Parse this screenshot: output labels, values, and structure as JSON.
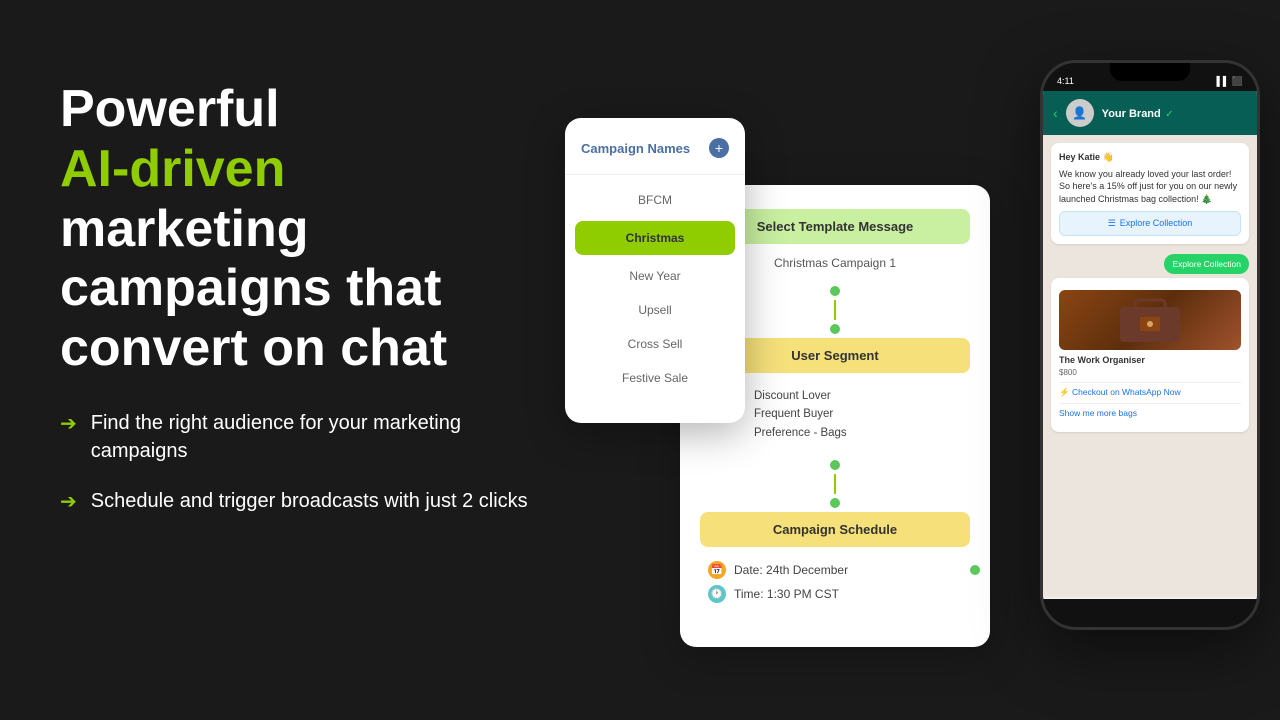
{
  "headline": {
    "line1": "Powerful",
    "line2": "AI-driven",
    "line3": "marketing",
    "line4": "campaigns that",
    "line5": "convert on chat"
  },
  "bullets": [
    {
      "id": "bullet-1",
      "text": "Find the right audience for your marketing campaigns"
    },
    {
      "id": "bullet-2",
      "text": "Schedule and trigger broadcasts with just 2 clicks"
    }
  ],
  "campaign_card": {
    "title": "Campaign Names",
    "plus_icon": "+",
    "items": [
      {
        "id": "bfcm",
        "label": "BFCM",
        "active": false
      },
      {
        "id": "christmas",
        "label": "Christmas",
        "active": true
      },
      {
        "id": "new-year",
        "label": "New Year",
        "active": false
      },
      {
        "id": "upsell",
        "label": "Upsell",
        "active": false
      },
      {
        "id": "cross-sell",
        "label": "Cross Sell",
        "active": false
      },
      {
        "id": "festive-sale",
        "label": "Festive Sale",
        "active": false
      }
    ]
  },
  "flow_card": {
    "template_header": "Select Template Message",
    "template_value": "Christmas Campaign 1",
    "segment_header": "User Segment",
    "segment_lines": [
      "Discount Lover",
      "Frequent Buyer",
      "Preference - Bags"
    ],
    "schedule_header": "Campaign Schedule",
    "schedule_date_label": "Date: 24th December",
    "schedule_time_label": "Time: 1:30 PM CST"
  },
  "phone": {
    "time": "4:11",
    "signal_icons": "▌▌ WiFi ⬛",
    "brand_name": "Your Brand",
    "verified_icon": "✓",
    "back_icon": "‹",
    "chat_greeting": "Hey Katie 👋",
    "chat_body": "We know you already loved your last order! So here's a 15% off just for you on our newly launched Christmas bag collection! 🎄",
    "explore_btn_label": "Explore Collection",
    "explore_sent_label": "Explore Collection",
    "product_name": "The Work Organiser",
    "product_price": "$800",
    "checkout_label": "⚡ Checkout on WhatsApp Now",
    "show_more_label": "Show me more bags"
  },
  "colors": {
    "background": "#1a1a1a",
    "accent_green": "#8fcc00",
    "flow_green_bg": "#c8f0a0",
    "flow_yellow_bg": "#f5e07a",
    "active_item_bg": "#8fcc00",
    "dot_green": "#5ac85a",
    "whatsapp_green": "#25d366",
    "whatsapp_dark": "#075e54"
  }
}
